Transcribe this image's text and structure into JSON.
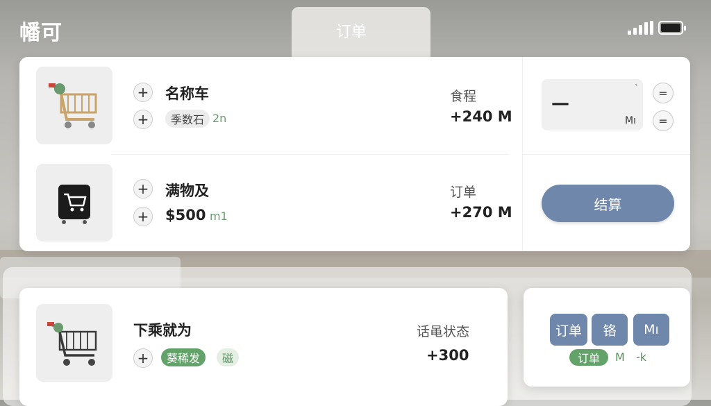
{
  "status": {
    "app_title": "幡可",
    "page_title": "订单",
    "icons": {
      "signal": "signal-icon",
      "battery": "battery-icon"
    }
  },
  "items": [
    {
      "name": "名称车",
      "tag": "季数石",
      "tag_unit": "2n",
      "col_label": "食程",
      "col_value": "+240 M",
      "thumb_icon": "shopping-cart-icon"
    },
    {
      "name": "满物及",
      "price": "$500",
      "price_unit": "m1",
      "col_label": "订单",
      "col_value": "+270 M",
      "thumb_icon": "cart-box-icon"
    },
    {
      "name": "下乘就为",
      "chip_green": "葵稀发",
      "chip_light": "磁",
      "col_label": "话黾状态",
      "col_value": "+300",
      "thumb_icon": "shopping-cart-icon"
    }
  ],
  "quantity": {
    "value": "—",
    "tick": "`",
    "unit": "Mı",
    "eq_label": "="
  },
  "checkout_label": "结算",
  "side_buttons": [
    "订单",
    "铬",
    "Mı"
  ],
  "side_chip": "订单",
  "side_texts": [
    "M",
    "-k"
  ],
  "colors": {
    "accent": "#6f87ab",
    "green": "#63a36a"
  }
}
